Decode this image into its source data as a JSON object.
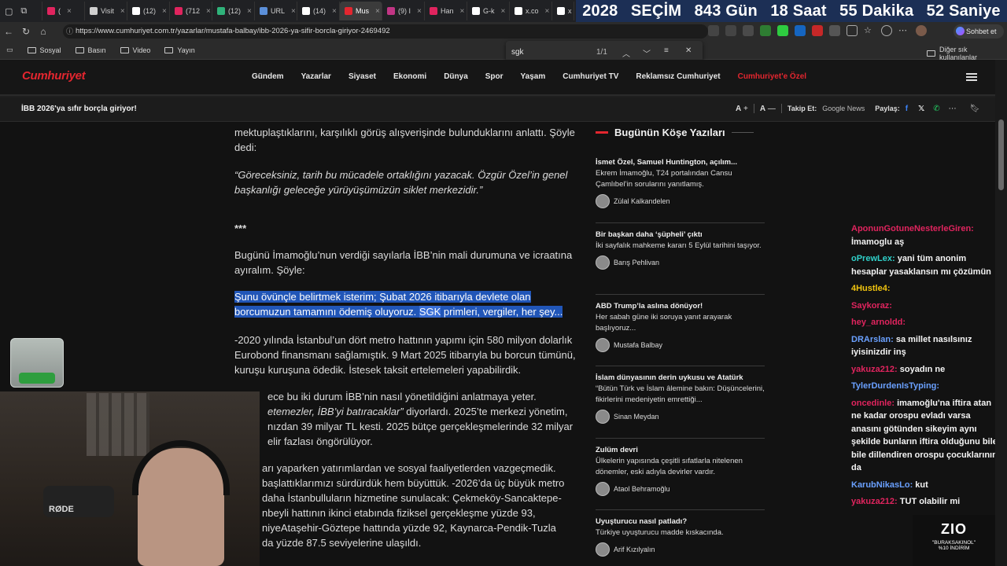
{
  "browser": {
    "tabs": [
      {
        "label": "(",
        "color": "#e0245e"
      },
      {
        "label": "Visit",
        "color": "#cfcfcf"
      },
      {
        "label": "(12)",
        "color": "#ffffff"
      },
      {
        "label": "(712",
        "color": "#e0245e"
      },
      {
        "label": "(12)",
        "color": "#2fb27a"
      },
      {
        "label": "URL",
        "color": "#5b8fd9"
      },
      {
        "label": "(14)",
        "color": "#ffffff"
      },
      {
        "label": "Mus",
        "color": "#e3262f"
      },
      {
        "label": "(9) I",
        "color": "#c13584"
      },
      {
        "label": "Han",
        "color": "#e0245e"
      },
      {
        "label": "G-k",
        "color": "#ffffff"
      },
      {
        "label": "x.co",
        "color": "#ffffff"
      },
      {
        "label": "x",
        "color": "#ffffff"
      }
    ],
    "url": "https://www.cumhuriyet.com.tr/yazarlar/mustafa-balbay/ibb-2026-ya-sifir-borcla-giriyor-2469492",
    "copilot_label": "Sohbet et",
    "bookmarks": [
      "Sosyal",
      "Basın",
      "Video",
      "Yayın"
    ],
    "other_bookmarks": "Diğer sık kullanılanlar",
    "find": {
      "query": "sgk",
      "count": "1/1"
    }
  },
  "countdown": {
    "year": "2028",
    "label": "SEÇİM",
    "days": "843 Gün",
    "hours": "18 Saat",
    "minutes": "55 Dakika",
    "seconds": "52 Saniye"
  },
  "site": {
    "logo": "Cumhuriyet",
    "menu": [
      "Gündem",
      "Yazarlar",
      "Siyaset",
      "Ekonomi",
      "Dünya",
      "Spor",
      "Yaşam",
      "Cumhuriyet TV",
      "Reklamsız Cumhuriyet",
      "Cumhuriyet'e Özel"
    ],
    "menu_special_color": "#e3262f",
    "article_short_title": "İBB 2026'ya sıfır borçla giriyor!",
    "toolbar": {
      "font_a_plus": "A",
      "font_plus": "+",
      "font_a_minus": "A",
      "font_minus": "—",
      "follow_label": "Takip Et:",
      "google_news": "Google News",
      "share_label": "Paylaş:"
    }
  },
  "article": {
    "p1": "mektuplaştıklarını, karşılıklı görüş alışverişinde bulunduklarını anlattı. Şöyle dedi:",
    "quote": "“Göreceksiniz, tarih bu mücadele ortaklığını yazacak. Özgür Özel’in genel başkanlığı geleceğe yürüyüşümüzün siklet merkezidir.”",
    "stars": "***",
    "p2": "Bugünü İmamoğlu’nun verdiği sayılarla İBB’nin mali durumuna ve icraatına ayıralım. Şöyle:",
    "p3_before": "Şunu övünçle belirtmek isterim; Şubat 2026 itibarıyla devlete olan borcumuzun tamamını ödemiş oluyoruz. ",
    "p3_match": "SGK",
    "p3_after": " primleri, vergiler, her şey...",
    "p4": "-2020 yılında İstanbul’un dört metro hattının yapımı için 580 milyon dolarlık Eurobond finansmanı sağlamıştık. 9 Mart 2025 itibarıyla bu borcun tümünü, kuruşu kuruşuna ödedik. İstesek taksit ertelemeleri yapabilirdik.",
    "p5a": "ece bu iki durum İBB’nin nasıl yönetildiğini anlatmaya yeter.",
    "p5b_quote": "etemezler, İBB’yi batıracaklar”",
    "p5b_rest": " diyorlardı. 2025’te merkezi yönetim,",
    "p5c": "nızdan 39 milyar TL kesti. 2025 bütçe gerçekleşmelerinde 32 milyar",
    "p5d": "elir fazlası öngörülüyor.",
    "p6a": "arı yaparken yatırımlardan ve sosyal faaliyetlerden vazgeçmedik.",
    "p6b": "başlattıklarımızı sürdürdük hem büyüttük. -2026’da üç büyük metro",
    "p6c": "daha İstanbulluların hizmetine sunulacak: Çekmeköy-Sancaktepe-",
    "p6d": "nbeyli hattının ikinci etabında fiziksel gerçekleşme yüzde 93,",
    "p6e": "niyeAtaşehir-Göztepe hattında yüzde 92, Kaynarca-Pendik-Tuzla",
    "p6f": "da yüzde 87.5 seviyelerine ulaşıldı."
  },
  "sidebar": {
    "heading": "Bugünün Köşe Yazıları",
    "items": [
      {
        "title": "İsmet Özel, Samuel Huntington, açılım...",
        "sub": "Ekrem İmamoğlu, T24 portalından Cansu Çamlıbel’in sorularını yanıtlamış.",
        "author": "Zülal Kalkandelen"
      },
      {
        "title": "Bir başkan daha ‘şüpheli’ çıktı",
        "sub": "İki sayfalık mahkeme kararı 5 Eylül tarihini taşıyor.",
        "author": "Barış Pehlivan"
      },
      {
        "title": "ABD Trump’la aslına dönüyor!",
        "sub": "Her sabah güne iki soruya yanıt arayarak başlıyoruz...",
        "author": "Mustafa Balbay"
      },
      {
        "title": "İslam dünyasının derin uykusu ve Atatürk",
        "sub": "“Bütün Türk ve İslam âlemine bakın: Düşüncelerini, fikirlerini medeniyetin emrettiği...",
        "author": "Sinan Meydan"
      },
      {
        "title": "Zulüm devri",
        "sub": "Ülkelerin yapısında çeşitli sıfatlarla nitelenen dönemler, eski adıyla devirler vardır.",
        "author": "Ataol Behramoğlu"
      },
      {
        "title": "Uyuşturucu nasıl patladı?",
        "sub": "Türkiye uyuşturucu madde kıskacında.",
        "author": "Arif Kızılyalın"
      }
    ]
  },
  "chat": [
    {
      "user": "AponunGotuneNesterleGiren:",
      "color": "#e0245e",
      "msg": " İmamoglu aş"
    },
    {
      "user": "oPrewLex:",
      "color": "#2fd0c9",
      "msg": " yani tüm anonim hesaplar yasaklansın mı çözümün"
    },
    {
      "user": "4Hustle4:",
      "color": "#f1c40f",
      "msg": ""
    },
    {
      "user": "Saykoraz:",
      "color": "#e0245e",
      "msg": ""
    },
    {
      "user": "hey_arnoldd:",
      "color": "#e0245e",
      "msg": ""
    },
    {
      "user": "DRArslan:",
      "color": "#6aa0ff",
      "msg": " sa millet nasılsınız iyisinizdir inş"
    },
    {
      "user": "yakuza212:",
      "color": "#e0245e",
      "msg": " soyadın ne"
    },
    {
      "user": "TylerDurdenIsTyping:",
      "color": "#6aa0ff",
      "msg": ""
    },
    {
      "user": "oncedinle:",
      "color": "#e0245e",
      "msg": " imamoğlu'na iftira atan ne kadar orospu evladı varsa anasını götünden sikeyim aynı şekilde bunların iftira olduğunu bile bile dillendiren orospu çocuklarının da"
    },
    {
      "user": "KarubNikasLo:",
      "color": "#6aa0ff",
      "msg": " kut"
    },
    {
      "user": "yakuza212:",
      "color": "#e0245e",
      "msg": " TUT olabilir mi"
    }
  ],
  "overlay": {
    "zio_logo": "ZIO",
    "zio_line1": "\"BURAKSAKINOL\"",
    "zio_line2": "%10 İNDİRİM",
    "mic_brand": "RØDE"
  }
}
